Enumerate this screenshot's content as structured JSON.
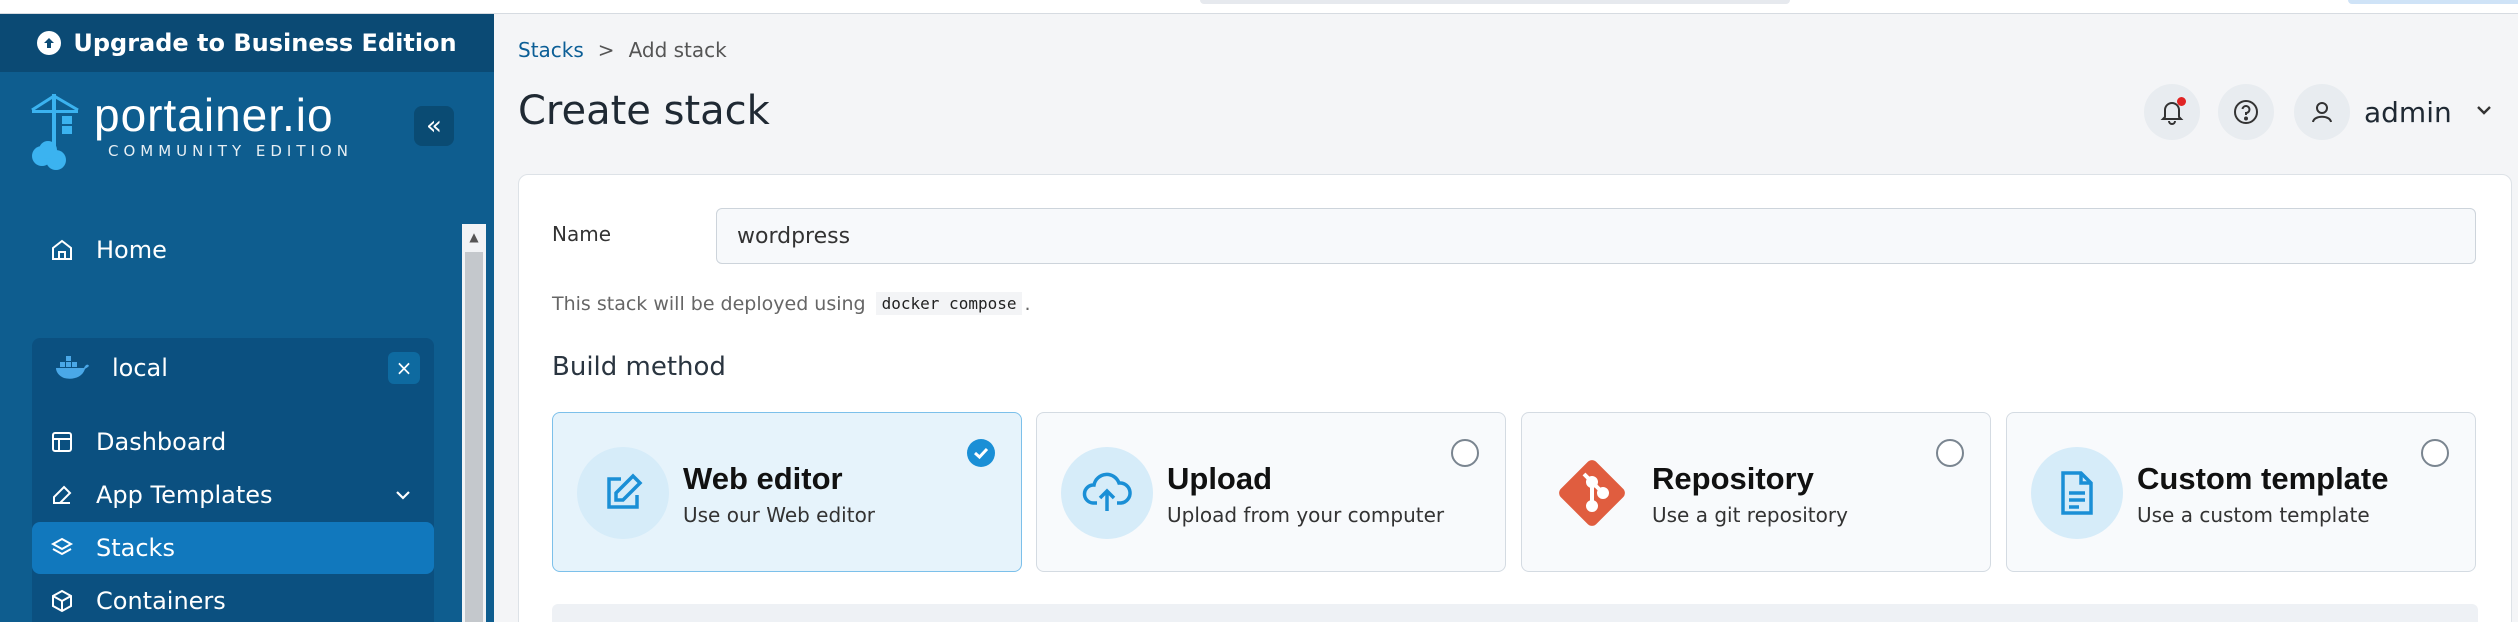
{
  "upgrade": {
    "label": "Upgrade to Business Edition"
  },
  "brand": {
    "name": "portainer.io",
    "edition": "COMMUNITY EDITION"
  },
  "sidebar": {
    "collapse_label": "«",
    "home": "Home",
    "environment": {
      "name": "local",
      "close": "×"
    },
    "items": [
      {
        "label": "Dashboard",
        "icon": "dashboard-icon"
      },
      {
        "label": "App Templates",
        "icon": "edit-icon"
      },
      {
        "label": "Stacks",
        "icon": "layers-icon",
        "active": true
      },
      {
        "label": "Containers",
        "icon": "cube-icon"
      }
    ]
  },
  "breadcrumb": {
    "parent": "Stacks",
    "separator": ">",
    "current": "Add stack"
  },
  "page": {
    "title": "Create stack"
  },
  "user": {
    "name": "admin"
  },
  "form": {
    "name_label": "Name",
    "name_value": "wordpress",
    "hint_prefix": "This stack will be deployed using",
    "hint_code": "docker compose",
    "hint_suffix": "."
  },
  "build": {
    "title": "Build method",
    "methods": [
      {
        "title": "Web editor",
        "subtitle": "Use our Web editor",
        "icon": "edit-icon",
        "selected": true
      },
      {
        "title": "Upload",
        "subtitle": "Upload from your computer",
        "icon": "upload-cloud-icon",
        "selected": false
      },
      {
        "title": "Repository",
        "subtitle": "Use a git repository",
        "icon": "git-icon",
        "selected": false
      },
      {
        "title": "Custom template",
        "subtitle": "Use a custom template",
        "icon": "file-text-icon",
        "selected": false
      }
    ]
  },
  "colors": {
    "sidebar": "#0e5d8f",
    "accent": "#1a8fd6",
    "git": "#e05d3f"
  }
}
